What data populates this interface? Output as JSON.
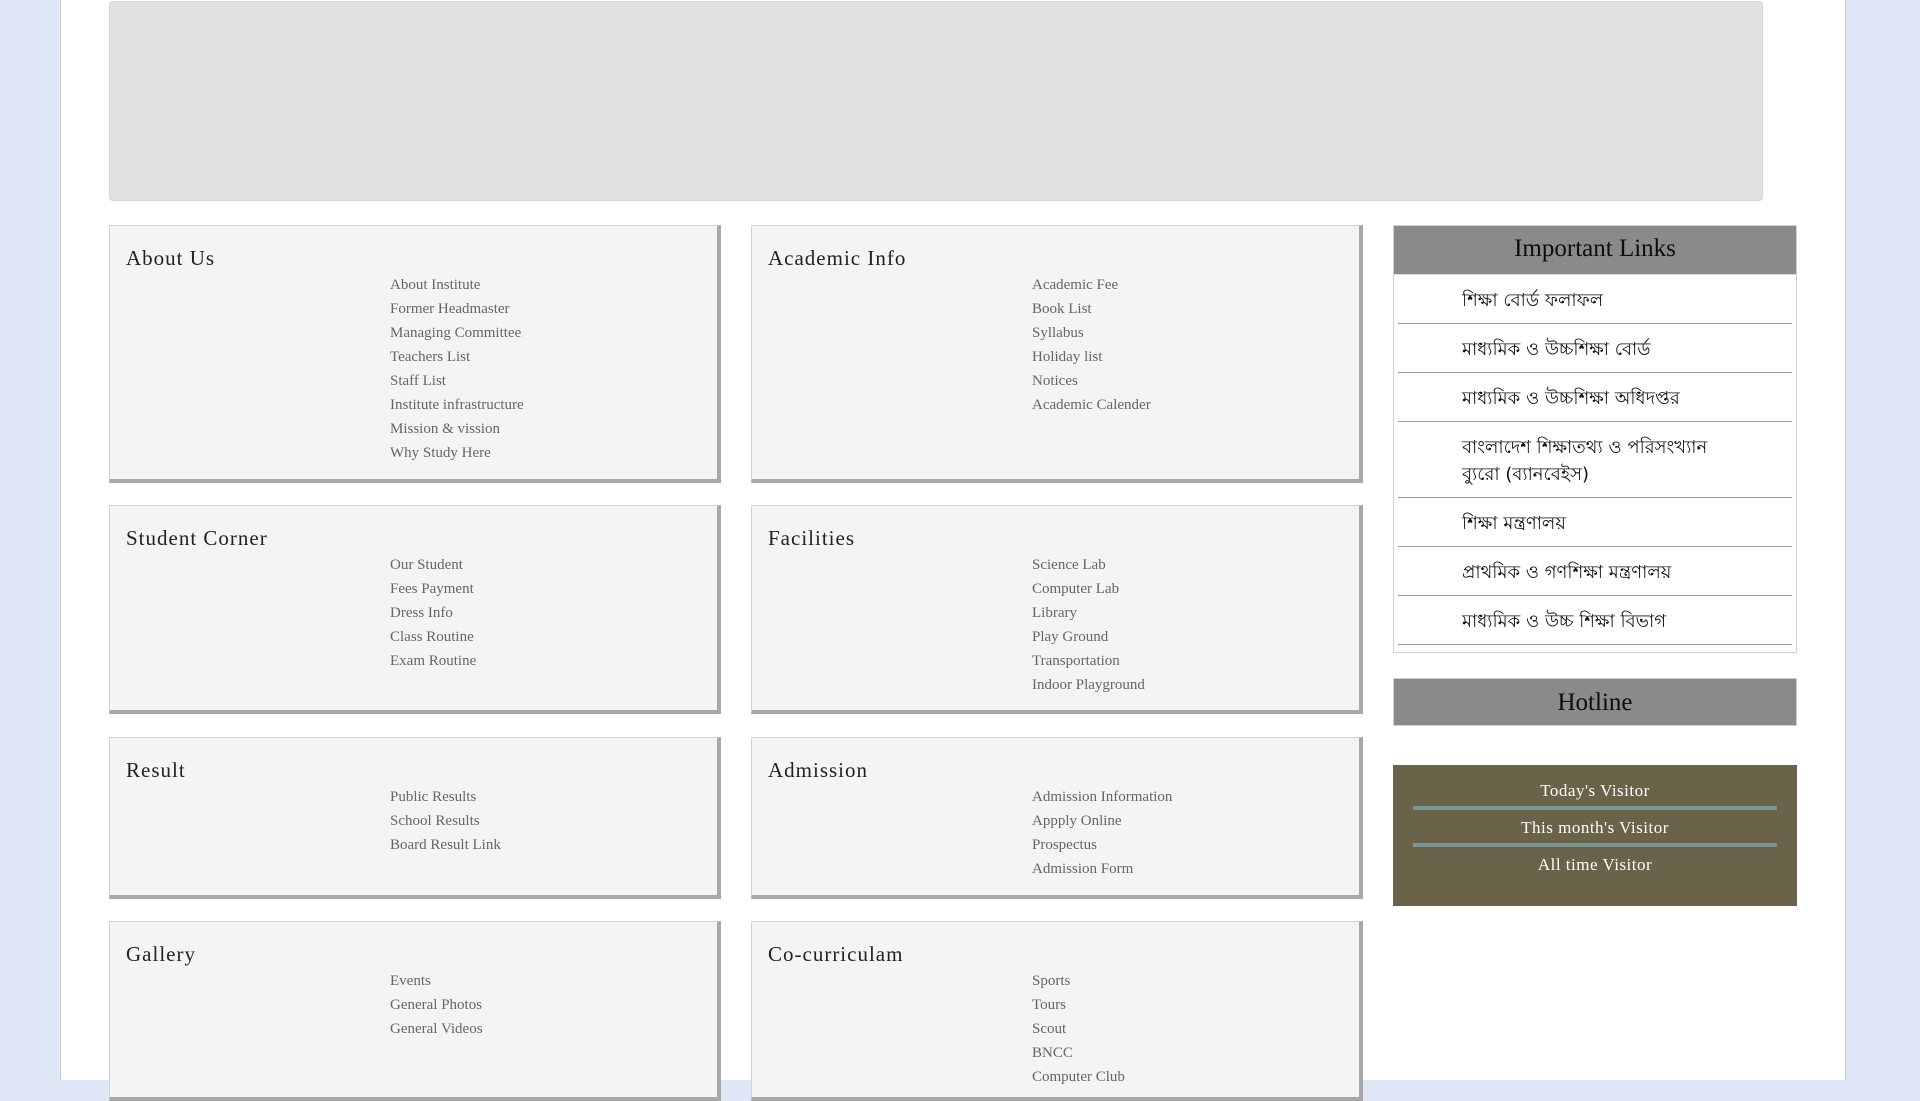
{
  "sections": {
    "about": {
      "title": "About Us",
      "items": [
        "About Institute",
        "Former Headmaster",
        "Managing Committee",
        "Teachers List",
        "Staff List",
        "Institute infrastructure",
        "Mission & vission",
        "Why Study Here"
      ]
    },
    "academic": {
      "title": "Academic Info",
      "items": [
        "Academic Fee",
        "Book List",
        "Syllabus",
        "Holiday list",
        "Notices",
        "Academic Calender"
      ]
    },
    "student": {
      "title": "Student Corner",
      "items": [
        "Our Student",
        "Fees Payment",
        "Dress Info",
        "Class Routine",
        "Exam Routine"
      ]
    },
    "facilities": {
      "title": "Facilities",
      "items": [
        "Science Lab",
        "Computer Lab",
        "Library",
        "Play Ground",
        "Transportation",
        "Indoor Playground"
      ]
    },
    "result": {
      "title": "Result",
      "items": [
        "Public Results",
        "School Results",
        "Board Result Link"
      ]
    },
    "admission": {
      "title": "Admission",
      "items": [
        "Admission Information",
        "Appply Online",
        "Prospectus",
        "Admission Form"
      ]
    },
    "gallery": {
      "title": "Gallery",
      "items": [
        "Events",
        "General Photos",
        "General Videos"
      ]
    },
    "cocurricular": {
      "title": "Co-curriculam",
      "items": [
        "Sports",
        "Tours",
        "Scout",
        "BNCC",
        "Computer Club"
      ]
    }
  },
  "important_links": {
    "title": "Important Links",
    "items": [
      "শিক্ষা বোর্ড ফলাফল",
      "মাধ্যমিক ও উচ্চশিক্ষা বোর্ড",
      "মাধ্যমিক ও উচ্চশিক্ষা অধিদপ্তর",
      "বাংলাদেশ শিক্ষাতথ্য ও পরিসংখ্যান ব্যুরো (ব্যানবেইস)",
      "শিক্ষা মন্ত্রণালয়",
      "প্রাথমিক ও গণশিক্ষা মন্ত্রণালয়",
      "মাধ্যমিক ও উচ্চ শিক্ষা বিভাগ"
    ]
  },
  "hotline": {
    "title": "Hotline"
  },
  "visitors": {
    "today": "Today's Visitor",
    "month": "This month's Visitor",
    "all_time": "All time Visitor"
  }
}
